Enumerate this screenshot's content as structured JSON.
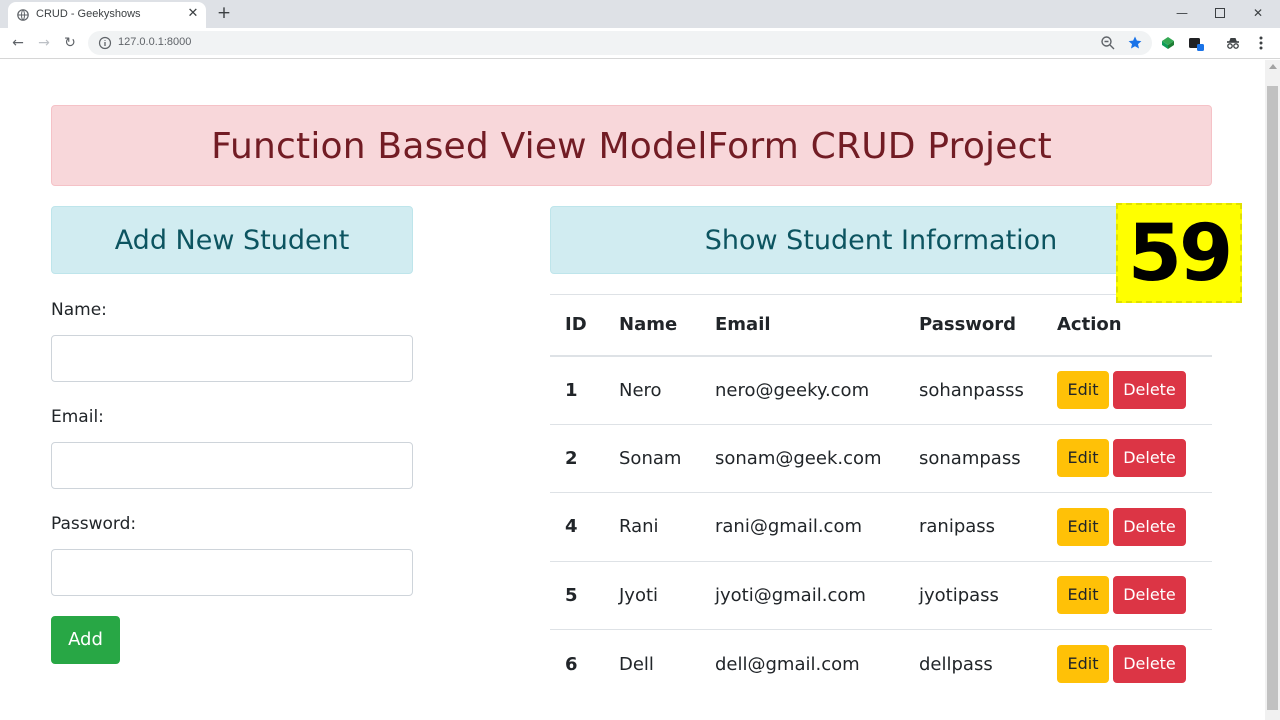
{
  "browser": {
    "tab_title": "CRUD - Geekyshows",
    "url": "127.0.0.1:8000",
    "icons": [
      "globe-icon",
      "close-icon",
      "plus-icon",
      "back-icon",
      "forward-icon",
      "reload-icon",
      "info-icon",
      "zoom-icon",
      "star-icon",
      "extension-icon",
      "profile-icon",
      "menu-icon"
    ]
  },
  "page": {
    "heading": "Function Based View ModelForm CRUD Project",
    "add_section": {
      "title": "Add New Student",
      "name_label": "Name:",
      "email_label": "Email:",
      "password_label": "Password:",
      "name_value": "",
      "email_value": "",
      "password_value": "",
      "add_button": "Add"
    },
    "show_section": {
      "title": "Show Student Information",
      "headers": [
        "ID",
        "Name",
        "Email",
        "Password",
        "Action"
      ],
      "edit_label": "Edit",
      "delete_label": "Delete",
      "rows": [
        {
          "id": "1",
          "name": "Nero",
          "email": "nero@geeky.com",
          "password": "sohanpasss"
        },
        {
          "id": "2",
          "name": "Sonam",
          "email": "sonam@geek.com",
          "password": "sonampass"
        },
        {
          "id": "4",
          "name": "Rani",
          "email": "rani@gmail.com",
          "password": "ranipass"
        },
        {
          "id": "5",
          "name": "Jyoti",
          "email": "jyoti@gmail.com",
          "password": "jyotipass"
        },
        {
          "id": "6",
          "name": "Dell",
          "email": "dell@gmail.com",
          "password": "dellpass"
        }
      ]
    },
    "episode_badge": "59"
  },
  "colors": {
    "banner_bg": "#f8d7da",
    "banner_text": "#721c24",
    "info_bg": "#d1ecf1",
    "info_text": "#0c5460",
    "add_button": "#28a745",
    "edit_button": "#ffc107",
    "delete_button": "#dc3545",
    "badge_bg": "#ffff00"
  }
}
